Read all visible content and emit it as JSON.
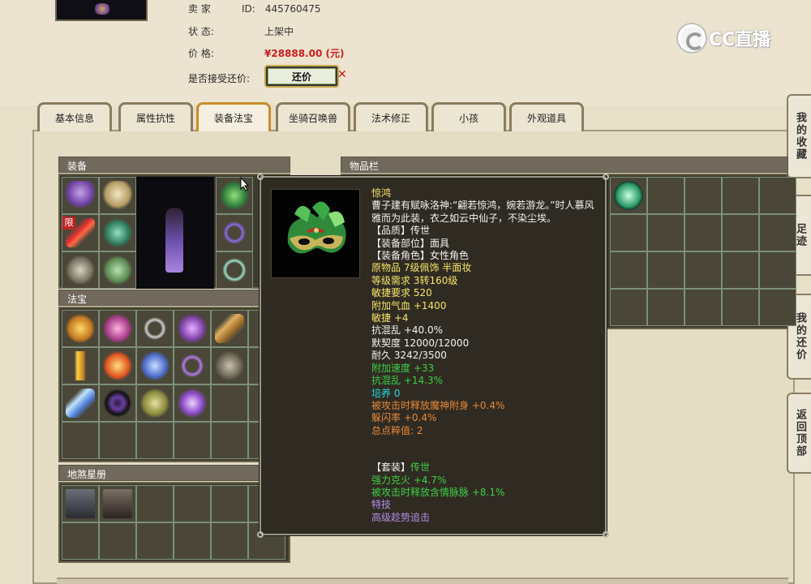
{
  "listing": {
    "seller_label": "卖 家",
    "seller_id_label": "ID:",
    "seller_id": "445760475",
    "status_label": "状 态:",
    "status": "上架中",
    "price_label": "价 格:",
    "price": "¥28888.00 (元)",
    "accept_label": "是否接受还价:",
    "haggle_button": "还价"
  },
  "logo": {
    "text": "CC直播"
  },
  "tabs": [
    "基本信息",
    "属性抗性",
    "装备法宝",
    "坐骑召唤兽",
    "法术修正",
    "小孩",
    "外观道具"
  ],
  "active_tab": 2,
  "side_nav": [
    {
      "label": "我的收藏"
    },
    {
      "label": "足迹"
    },
    {
      "label": "我的还价"
    },
    {
      "label": "返回顶部"
    }
  ],
  "sections": {
    "equip": "装备",
    "fabao": "法宝",
    "dishaxingce": "地煞星册",
    "inventory": "物品栏"
  },
  "badge_limit": "限",
  "tooltip": {
    "name": "惊鸿",
    "desc": "曹子建有赋咏洛神:“翩若惊鸿，婉若游龙。”时人慕风雅而为此装，衣之如云中仙子，不染尘埃。",
    "lines": [
      {
        "text": "【品质】传世",
        "color": "white"
      },
      {
        "text": "【装备部位】面具",
        "color": "white"
      },
      {
        "text": "【装备角色】女性角色",
        "color": "white"
      },
      {
        "text": "原物品 7级佩饰 半面妆",
        "color": "yellow"
      },
      {
        "text": "等级需求 3转160级",
        "color": "yellow"
      },
      {
        "text": "敏捷要求 520",
        "color": "yellow"
      },
      {
        "text": "附加气血 +1400",
        "color": "yellow"
      },
      {
        "text": "敏捷 +4",
        "color": "yellow"
      },
      {
        "text": "抗混乱 +40.0%",
        "color": "white"
      },
      {
        "text": "默契度 12000/12000",
        "color": "white"
      },
      {
        "text": "耐久 3242/3500",
        "color": "white"
      },
      {
        "text": "附加速度 +33",
        "color": "green"
      },
      {
        "text": "抗混乱 +14.3%",
        "color": "green"
      },
      {
        "text": "培养 0",
        "color": "cyan"
      },
      {
        "text": "被攻击时释放魔神附身 +0.4%",
        "color": "orange"
      },
      {
        "text": "躲闪率 +0.4%",
        "color": "orange"
      },
      {
        "text": "总点粹值: 2",
        "color": "orange"
      }
    ],
    "set_label": "【套装】",
    "set_name": "传世",
    "set_lines": [
      {
        "text": "强力克火 +4.7%",
        "color": "green"
      },
      {
        "text": "被攻击时释放含情脉脉 +8.1%",
        "color": "green"
      }
    ],
    "skill_label": "特技",
    "skill": "高级趁势追击"
  },
  "colors": {
    "white": "#f2f2f2",
    "yellow": "#f4e56a",
    "green": "#3ecf46",
    "cyan": "#27d7e0",
    "orange": "#e8883a",
    "purple": "#b58ee8",
    "price_red": "#c81e1e",
    "active_tab_border": "#c78e2a"
  },
  "icons": {
    "equip_cells": [
      "purple-tentacle-icon",
      "skull-helmet-icon",
      "red-lightning-weapon-icon",
      "green-pants-icon",
      "claw-gloves-icon",
      "boots-icon",
      "green-mask-icon",
      "purple-ring-icon",
      "jade-necklace-icon"
    ],
    "fabao_cells": [
      "golden-cloud-icon",
      "pink-lantern-icon",
      "silver-whip-icon",
      "purple-bell-icon",
      "bamboo-scroll-icon",
      "pagoda-icon",
      "fire-bell-icon",
      "blue-claw-icon",
      "purple-rope-icon",
      "stone-tablet-icon",
      "blue-arm-icon",
      "dark-orb-icon",
      "bronze-cauldron-icon",
      "purple-sword-icon"
    ],
    "star_cells": [
      "warrior-card-icon",
      "demon-card-icon"
    ],
    "inventory_cells": [
      "green-orb-icon"
    ]
  }
}
